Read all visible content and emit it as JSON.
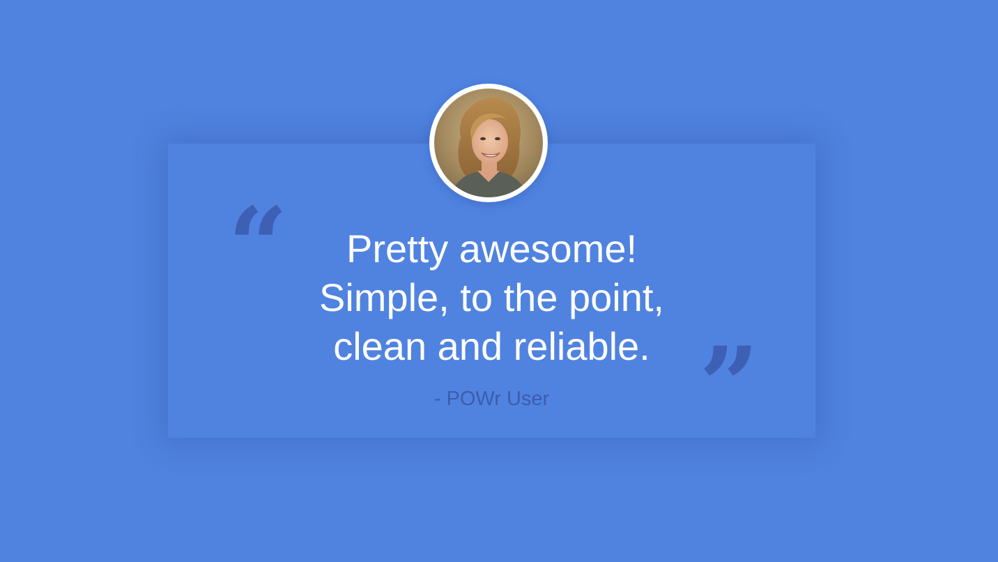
{
  "testimonial": {
    "quote_lines": [
      "Pretty awesome!",
      "Simple, to the point,",
      "clean and reliable."
    ],
    "author": "- POWr User",
    "open_quote": "“",
    "close_quote": "”"
  },
  "colors": {
    "background": "#4f83df",
    "card": "#5083e0",
    "quote_marks": "#3d5fb4",
    "author_text": "#3c5cad",
    "quote_text": "#ffffff"
  },
  "icons": {
    "avatar": "user-photo-avatar"
  }
}
